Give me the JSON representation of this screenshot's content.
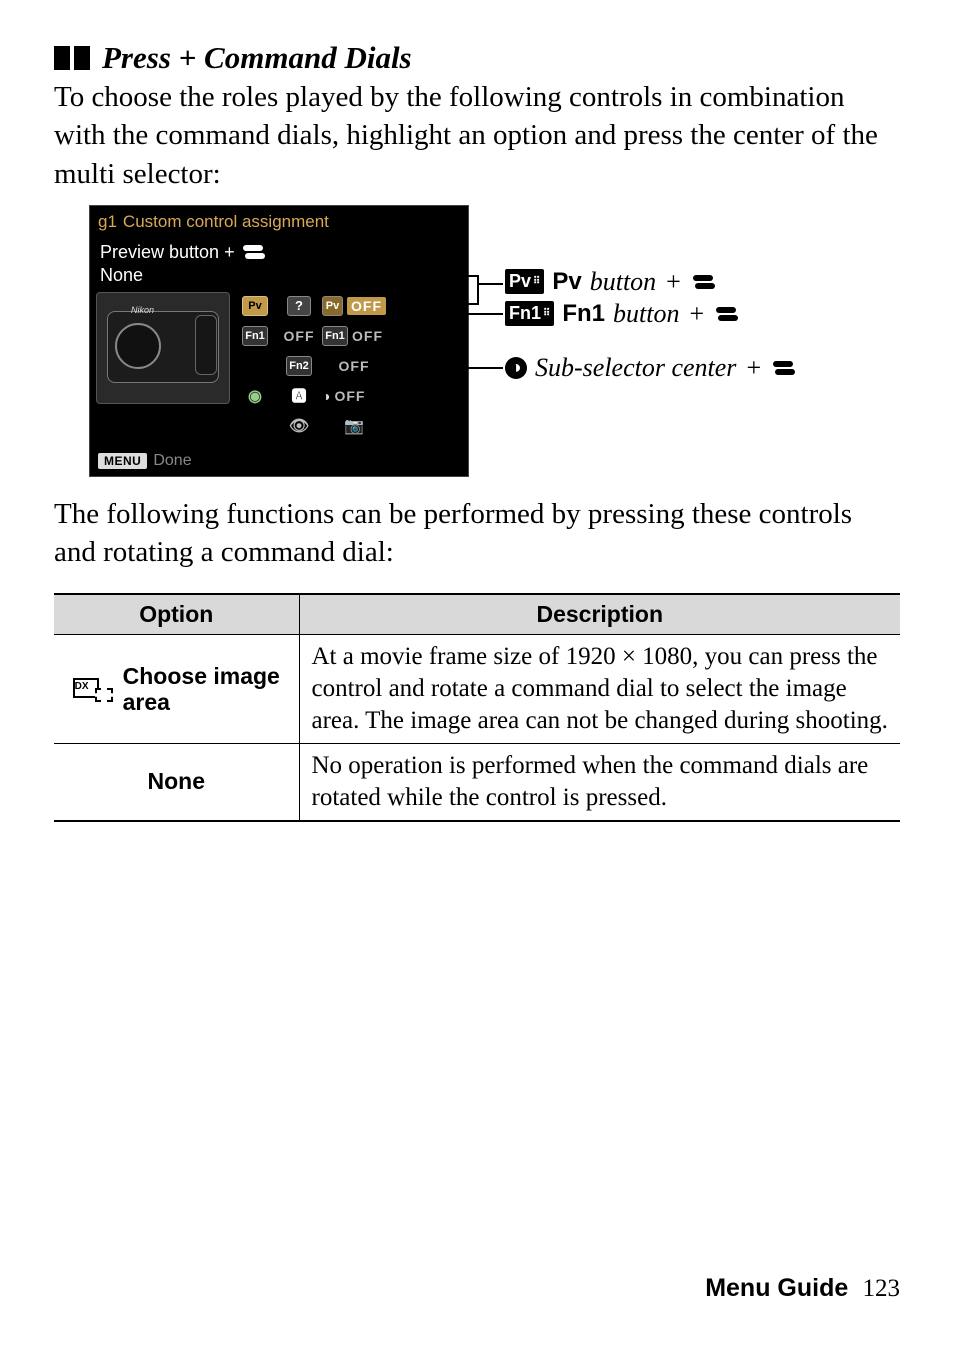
{
  "section": {
    "title": "Press + Command Dials",
    "intro": "To choose the roles played by the following controls in combination with the command dials, highlight an option and press the center of the multi selector:",
    "mid": "The following functions can be performed by pressing these controls and rotating a command dial:"
  },
  "screenshot": {
    "menu_code": "g1",
    "menu_title": "Custom control assignment",
    "sub_label": "Preview button +",
    "value": "None",
    "footer_menu": "MENU",
    "footer_done": "Done",
    "chips": {
      "pv": "Pv",
      "fn1": "Fn1",
      "fn2": "Fn2",
      "off": "OFF"
    }
  },
  "callouts": {
    "pv": {
      "icon": "Pv",
      "bold": "Pv",
      "italic": "button",
      "plus": "+"
    },
    "fn1": {
      "icon": "Fn1",
      "bold": "Fn1",
      "italic": "button",
      "plus": "+"
    },
    "sub": {
      "italic": "Sub-selector center",
      "plus": "+"
    }
  },
  "table": {
    "head_option": "Option",
    "head_desc": "Description",
    "rows": [
      {
        "label": "Choose image area",
        "desc": "At a movie frame size of 1920 × 1080, you can press the control and rotate a command dial to select the image area.  The image area can not be changed during shooting."
      },
      {
        "label": "None",
        "desc": "No operation is performed when the command dials are rotated while the control is pressed."
      }
    ]
  },
  "footer": {
    "label": "Menu Guide",
    "page": "123"
  }
}
